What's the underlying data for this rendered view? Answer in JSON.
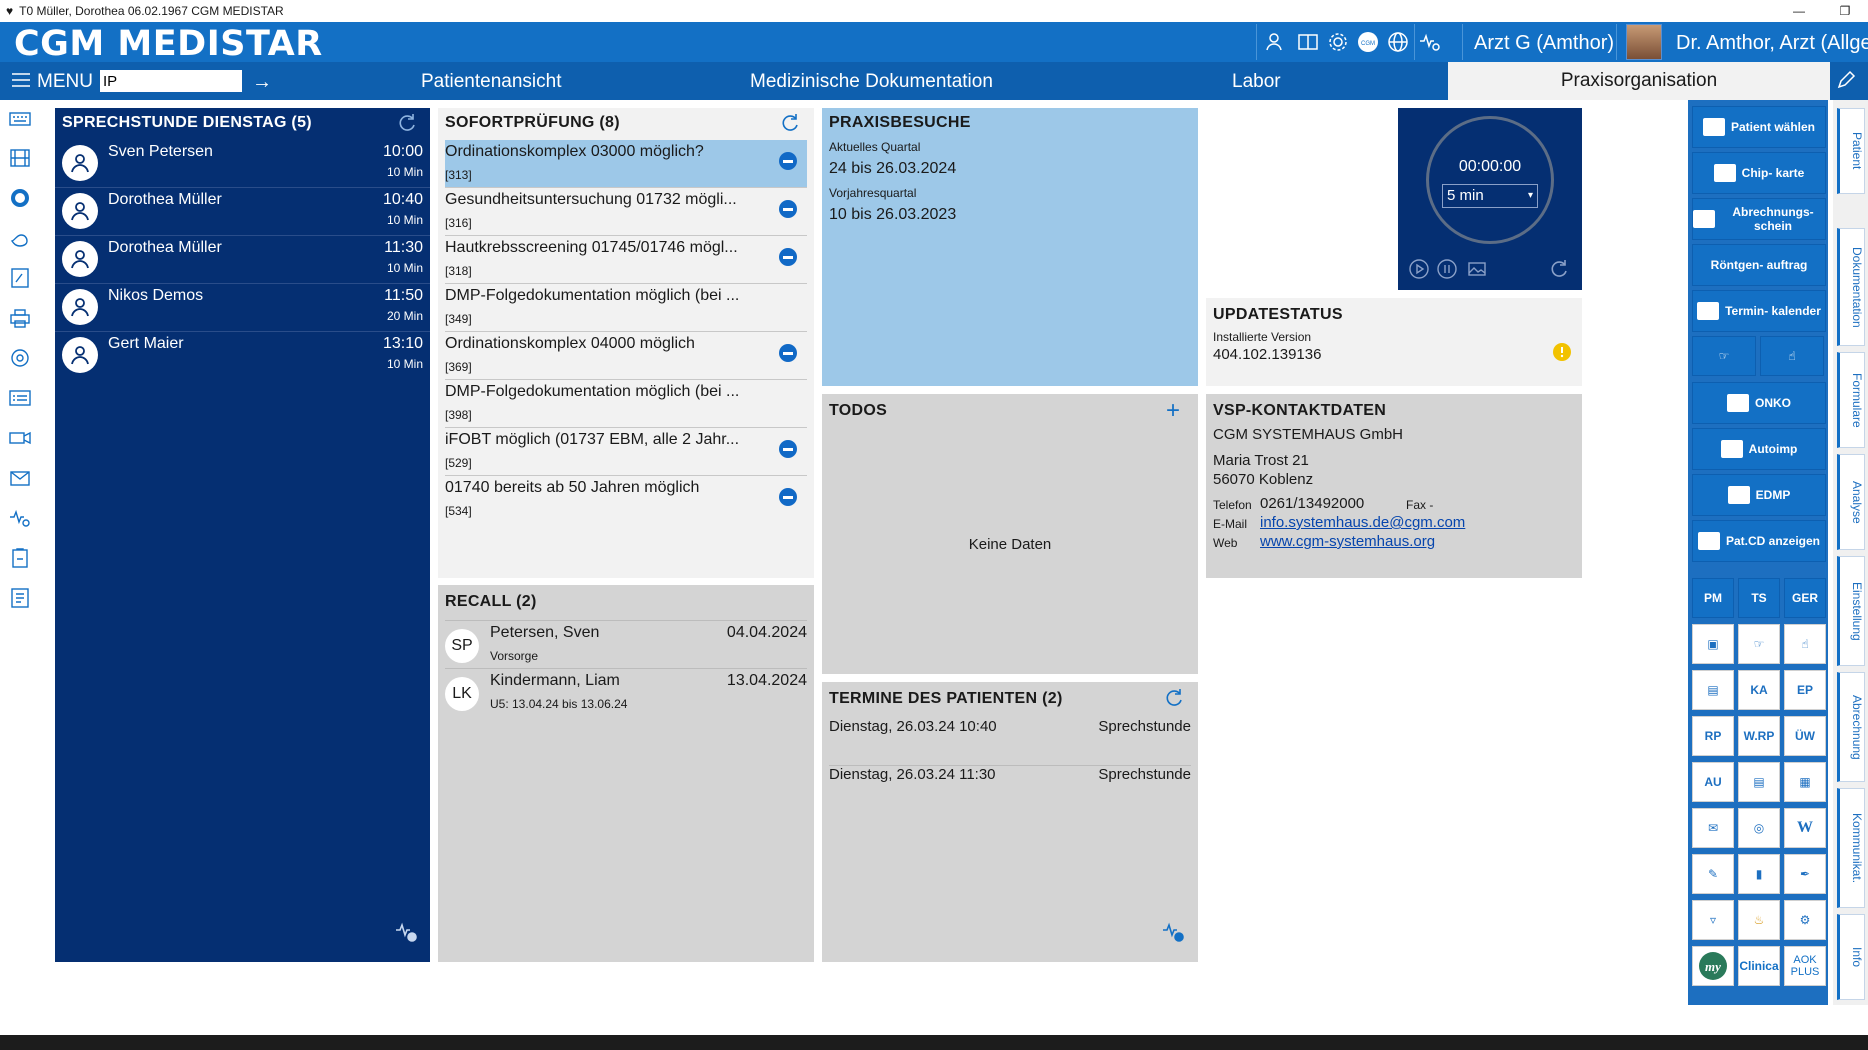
{
  "window": {
    "title": "T0 Müller, Dorothea 06.02.1967 CGM MEDISTAR",
    "minimize": "—",
    "maximize": "❐"
  },
  "app": {
    "brand": "CGM MEDISTAR",
    "user_role": "Arzt G (Amthor)",
    "user_name": "Dr. Amthor, Arzt (Allge"
  },
  "nav": {
    "menu_label": "MENU",
    "menu_input_value": "IP",
    "tabs": [
      "Patientenansicht",
      "Medizinische Dokumentation",
      "Labor"
    ],
    "active_tab": "Praxisorganisation"
  },
  "sprechstunde": {
    "title": "SPRECHSTUNDE DIENSTAG (5)",
    "rows": [
      {
        "name": "Sven Petersen",
        "time": "10:00",
        "duration": "10 Min"
      },
      {
        "name": "Dorothea Müller",
        "time": "10:40",
        "duration": "10 Min"
      },
      {
        "name": "Dorothea Müller",
        "time": "11:30",
        "duration": "10 Min"
      },
      {
        "name": "Nikos Demos",
        "time": "11:50",
        "duration": "20 Min"
      },
      {
        "name": "Gert Maier",
        "time": "13:10",
        "duration": "10 Min"
      }
    ]
  },
  "sofort": {
    "title": "SOFORTPRÜFUNG (8)",
    "rows": [
      {
        "label": "Ordinationskomplex 03000 möglich?",
        "code": "[313]"
      },
      {
        "label": "Gesundheitsuntersuchung 01732 mögli...",
        "code": "[316]"
      },
      {
        "label": "Hautkrebsscreening 01745/01746 mögl...",
        "code": "[318]"
      },
      {
        "label": "DMP-Folgedokumentation möglich (bei ...",
        "code": "[349]"
      },
      {
        "label": "Ordinationskomplex 04000 möglich",
        "code": "[369]"
      },
      {
        "label": "DMP-Folgedokumentation möglich (bei ...",
        "code": "[398]"
      },
      {
        "label": "iFOBT möglich (01737 EBM, alle 2 Jahr...",
        "code": "[529]"
      },
      {
        "label": "01740 bereits ab 50 Jahren möglich",
        "code": "[534]"
      }
    ]
  },
  "recall": {
    "title": "RECALL (2)",
    "rows": [
      {
        "initials": "SP",
        "name": "Petersen, Sven",
        "date": "04.04.2024",
        "sub": "Vorsorge"
      },
      {
        "initials": "LK",
        "name": "Kindermann, Liam",
        "date": "13.04.2024",
        "sub": "U5: 13.04.24 bis 13.06.24"
      }
    ]
  },
  "praxis": {
    "title": "PRAXISBESUCHE",
    "q1_label": "Aktuelles Quartal",
    "q1_value": "24 bis 26.03.2024",
    "q2_label": "Vorjahresquartal",
    "q2_value": "10 bis 26.03.2023"
  },
  "todos": {
    "title": "TODOS",
    "empty": "Keine Daten"
  },
  "termine": {
    "title": "TERMINE DES PATIENTEN (2)",
    "rows": [
      {
        "date": "Dienstag, 26.03.24 10:40",
        "type": "Sprechstunde"
      },
      {
        "date": "Dienstag, 26.03.24 11:30",
        "type": "Sprechstunde"
      }
    ]
  },
  "timer": {
    "time": "00:00:00",
    "select": "5 min"
  },
  "update": {
    "title": "UPDATESTATUS",
    "label": "Installierte Version",
    "version": "404.102.139136"
  },
  "vsp": {
    "title": "VSP-KONTAKTDATEN",
    "company": "CGM SYSTEMHAUS GmbH",
    "street": "Maria Trost 21",
    "city": "56070 Koblenz",
    "tel_label": "Telefon",
    "tel": "0261/13492000",
    "fax_label": "Fax -",
    "email_label": "E-Mail",
    "email": "info.systemhaus.de@cgm.com",
    "web_label": "Web",
    "web": "www.cgm-systemhaus.org"
  },
  "rightpanel": {
    "wide": [
      "Patient wählen",
      "Chip- karte",
      "Abrechnungs- schein",
      "Röntgen- auftrag",
      "Termin- kalender"
    ],
    "mid": [
      "ONKO",
      "Autoimp",
      "EDMP",
      "Pat.CD anzeigen"
    ],
    "grid1": [
      "PM",
      "TS",
      "GER"
    ],
    "grid2": [
      "KA",
      "EP"
    ],
    "grid3": [
      "RP",
      "W.RP",
      "ÜW"
    ],
    "grid4": [
      "AU"
    ],
    "bottom": [
      "Clinica",
      "AOK PLUS"
    ]
  },
  "sidetabs": [
    "Patient",
    "Dokumentation",
    "Formulare",
    "Analyse",
    "Einstellung",
    "Abrechnung",
    "Kommunikat.",
    "Info"
  ],
  "colors": {
    "brand_blue": "#1370c5",
    "navy": "#052f72",
    "light_blue": "#9dc8e8",
    "panel_gray": "#d4d4d4",
    "warning": "#f2c200"
  }
}
